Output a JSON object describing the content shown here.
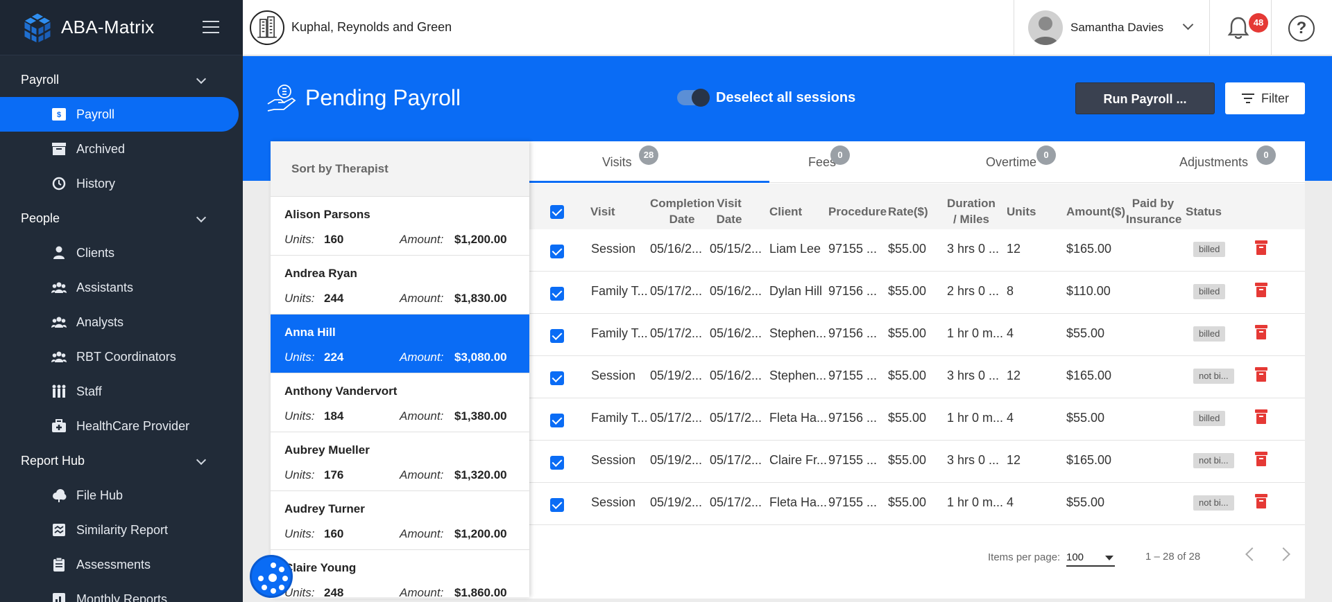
{
  "app": {
    "name": "ABA-Matrix"
  },
  "sidebar": {
    "sections": [
      {
        "label": "Payroll",
        "items": [
          {
            "label": "Payroll",
            "icon": "payroll-icon",
            "active": true
          },
          {
            "label": "Archived",
            "icon": "archive-icon"
          },
          {
            "label": "History",
            "icon": "history-icon"
          }
        ]
      },
      {
        "label": "People",
        "items": [
          {
            "label": "Clients",
            "icon": "person-icon"
          },
          {
            "label": "Assistants",
            "icon": "group-icon"
          },
          {
            "label": "Analysts",
            "icon": "group-icon"
          },
          {
            "label": "RBT Coordinators",
            "icon": "group-icon"
          },
          {
            "label": "Staff",
            "icon": "staff-icon"
          },
          {
            "label": "HealthCare Provider",
            "icon": "medical-kit-icon"
          }
        ]
      },
      {
        "label": "Report Hub",
        "items": [
          {
            "label": "File Hub",
            "icon": "cloud-icon"
          },
          {
            "label": "Similarity Report",
            "icon": "report-icon"
          },
          {
            "label": "Assessments",
            "icon": "clipboard-icon"
          },
          {
            "label": "Monthly Reports",
            "icon": "chart-icon"
          }
        ]
      }
    ]
  },
  "topbar": {
    "company": "Kuphal, Reynolds and Green",
    "user": "Samantha Davies",
    "notifications": "48"
  },
  "header": {
    "title": "Pending Payroll",
    "toggle_label": "Deselect all sessions",
    "run_button": "Run Payroll ...",
    "filter_button": "Filter"
  },
  "tabs": [
    {
      "label": "Visits",
      "count": "28"
    },
    {
      "label": "Fees",
      "count": "0"
    },
    {
      "label": "Overtime",
      "count": "0"
    },
    {
      "label": "Adjustments",
      "count": "0"
    }
  ],
  "table": {
    "columns": {
      "visit": "Visit",
      "completion": [
        "Completion",
        "Date"
      ],
      "visit_date": [
        "Visit",
        "Date"
      ],
      "client": "Client",
      "procedure": "Procedure",
      "rate": "Rate($)",
      "duration": [
        "Duration",
        "/ Miles"
      ],
      "units": "Units",
      "amount": "Amount($)",
      "paid": [
        "Paid by",
        "Insurance"
      ],
      "status": "Status"
    },
    "rows": [
      {
        "visit": "Session",
        "completion": "05/16/2...",
        "visit_date": "05/15/2...",
        "client": "Liam Lee",
        "procedure": "97155 ...",
        "rate": "$55.00",
        "duration": "3 hrs 0 ...",
        "units": "12",
        "amount": "$165.00",
        "status": "billed"
      },
      {
        "visit": "Family T...",
        "completion": "05/17/2...",
        "visit_date": "05/16/2...",
        "client": "Dylan Hill",
        "procedure": "97156 ...",
        "rate": "$55.00",
        "duration": "2 hrs 0 ...",
        "units": "8",
        "amount": "$110.00",
        "status": "billed"
      },
      {
        "visit": "Family T...",
        "completion": "05/17/2...",
        "visit_date": "05/16/2...",
        "client": "Stephen...",
        "procedure": "97156 ...",
        "rate": "$55.00",
        "duration": "1 hr 0 m...",
        "units": "4",
        "amount": "$55.00",
        "status": "billed"
      },
      {
        "visit": "Session",
        "completion": "05/19/2...",
        "visit_date": "05/16/2...",
        "client": "Stephen...",
        "procedure": "97155 ...",
        "rate": "$55.00",
        "duration": "3 hrs 0 ...",
        "units": "12",
        "amount": "$165.00",
        "status": "not bi..."
      },
      {
        "visit": "Family T...",
        "completion": "05/17/2...",
        "visit_date": "05/17/2...",
        "client": "Fleta Ha...",
        "procedure": "97156 ...",
        "rate": "$55.00",
        "duration": "1 hr 0 m...",
        "units": "4",
        "amount": "$55.00",
        "status": "billed"
      },
      {
        "visit": "Session",
        "completion": "05/19/2...",
        "visit_date": "05/17/2...",
        "client": "Claire Fr...",
        "procedure": "97155 ...",
        "rate": "$55.00",
        "duration": "3 hrs 0 ...",
        "units": "12",
        "amount": "$165.00",
        "status": "not bi..."
      },
      {
        "visit": "Session",
        "completion": "05/19/2...",
        "visit_date": "05/17/2...",
        "client": "Fleta Ha...",
        "procedure": "97155 ...",
        "rate": "$55.00",
        "duration": "1 hr 0 m...",
        "units": "4",
        "amount": "$55.00",
        "status": "not bi..."
      }
    ]
  },
  "pager": {
    "items_label": "Items per page:",
    "items_value": "100",
    "range": "1 – 28 of 28"
  },
  "therapists": {
    "title": "Sort by Therapist",
    "units_label": "Units:",
    "amount_label": "Amount:",
    "list": [
      {
        "name": "Alison Parsons",
        "units": "160",
        "amount": "$1,200.00"
      },
      {
        "name": "Andrea Ryan",
        "units": "244",
        "amount": "$1,830.00"
      },
      {
        "name": "Anna Hill",
        "units": "224",
        "amount": "$3,080.00",
        "selected": true
      },
      {
        "name": "Anthony Vandervort",
        "units": "184",
        "amount": "$1,380.00"
      },
      {
        "name": "Aubrey Mueller",
        "units": "176",
        "amount": "$1,320.00"
      },
      {
        "name": "Audrey Turner",
        "units": "160",
        "amount": "$1,200.00"
      },
      {
        "name": "Claire Young",
        "units": "248",
        "amount": "$1,860.00"
      }
    ]
  },
  "colors": {
    "primary": "#0a6cf5",
    "sidebar": "#212b38",
    "danger": "#e53935"
  }
}
